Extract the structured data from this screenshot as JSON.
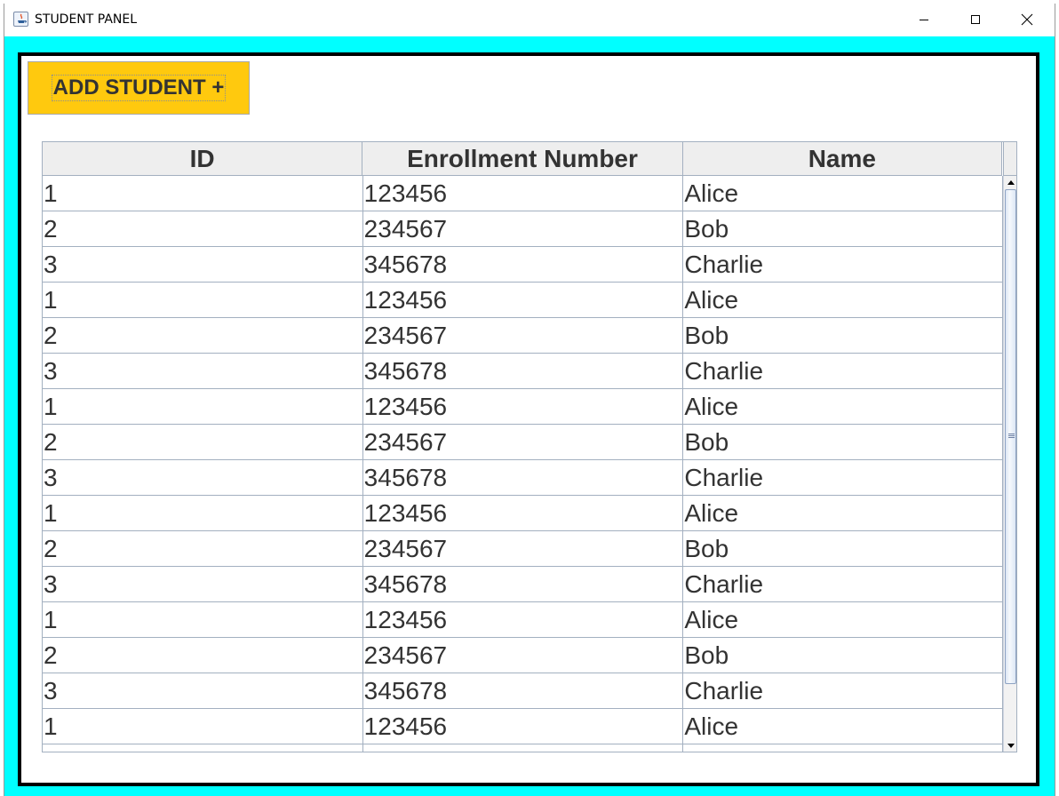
{
  "window": {
    "title": "STUDENT PANEL",
    "buttons": {
      "minimize": "minimize",
      "maximize": "maximize",
      "close": "close"
    }
  },
  "colors": {
    "background": "#00ffff",
    "button": "#ffc90e",
    "border": "#000000"
  },
  "toolbar": {
    "add_label": "ADD STUDENT +"
  },
  "table": {
    "columns": [
      "ID",
      "Enrollment Number",
      "Name"
    ],
    "rows": [
      [
        "1",
        "123456",
        "Alice"
      ],
      [
        "2",
        "234567",
        "Bob"
      ],
      [
        "3",
        "345678",
        "Charlie"
      ],
      [
        "1",
        "123456",
        "Alice"
      ],
      [
        "2",
        "234567",
        "Bob"
      ],
      [
        "3",
        "345678",
        "Charlie"
      ],
      [
        "1",
        "123456",
        "Alice"
      ],
      [
        "2",
        "234567",
        "Bob"
      ],
      [
        "3",
        "345678",
        "Charlie"
      ],
      [
        "1",
        "123456",
        "Alice"
      ],
      [
        "2",
        "234567",
        "Bob"
      ],
      [
        "3",
        "345678",
        "Charlie"
      ],
      [
        "1",
        "123456",
        "Alice"
      ],
      [
        "2",
        "234567",
        "Bob"
      ],
      [
        "3",
        "345678",
        "Charlie"
      ],
      [
        "1",
        "123456",
        "Alice"
      ],
      [
        "",
        "",
        ""
      ]
    ]
  }
}
